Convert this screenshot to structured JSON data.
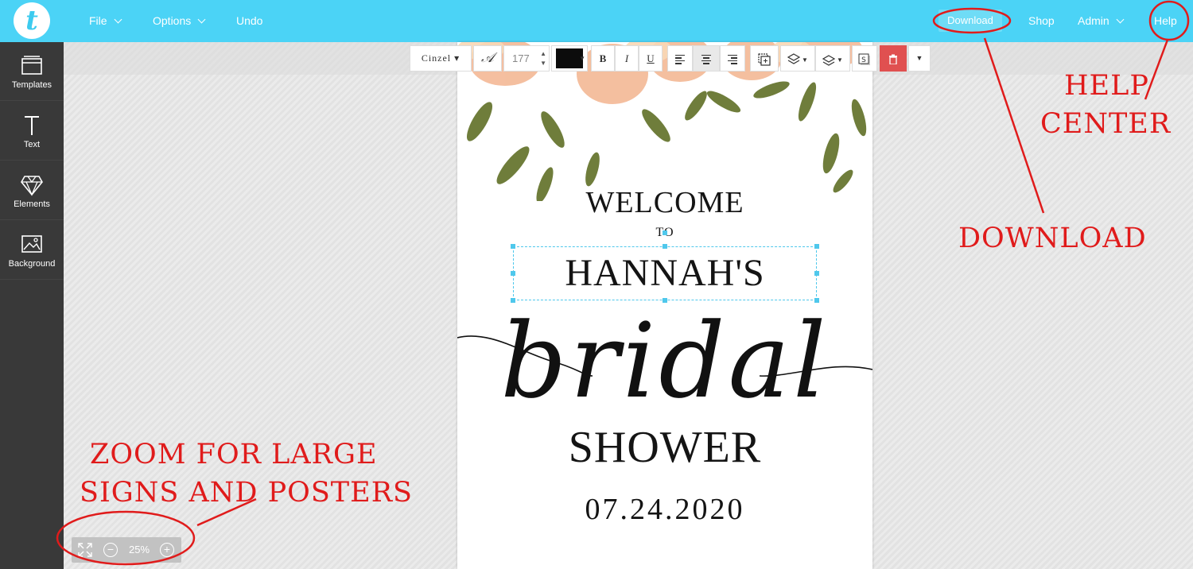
{
  "app": {
    "logo_letter": "t"
  },
  "nav": {
    "file": "File",
    "options": "Options",
    "undo": "Undo",
    "download": "Download",
    "shop": "Shop",
    "admin": "Admin",
    "help": "Help"
  },
  "sidebar": {
    "items": [
      {
        "label": "Templates",
        "icon": "templates-icon"
      },
      {
        "label": "Text",
        "icon": "text-icon"
      },
      {
        "label": "Elements",
        "icon": "diamond-icon"
      },
      {
        "label": "Background",
        "icon": "image-icon"
      }
    ]
  },
  "toolbar": {
    "font": "Cinzel",
    "font_size": "177",
    "color": "#0c0c0c",
    "bold": "B",
    "italic": "I",
    "underline": "U"
  },
  "canvas": {
    "line1": "WELCOME",
    "line2": "TO",
    "line3": "HANNAH'S",
    "line4": "bridal",
    "line5": "SHOWER",
    "line6": "07.24.2020"
  },
  "zoom": {
    "level": "25%"
  },
  "annotations": {
    "help_line1": "HELP",
    "help_line2": "CENTER",
    "download": "DOWNLOAD",
    "zoom_line1": "ZOOM FOR LARGE",
    "zoom_line2": "SIGNS AND POSTERS"
  },
  "colors": {
    "topbar": "#4bd3f6",
    "sidebar": "#393939",
    "annotation": "#e01b1b",
    "delete": "#e05050"
  }
}
